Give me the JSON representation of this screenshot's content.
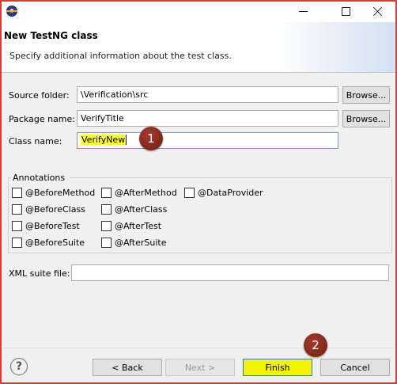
{
  "window": {
    "title": "",
    "banner_title": "New TestNG class",
    "banner_subtitle": "Specify additional information about the test class."
  },
  "form": {
    "source_folder_label": "Source folder:",
    "source_folder_value": "\\Verification\\src",
    "package_name_label": "Package name:",
    "package_name_value": "VerifyTitle",
    "class_name_label": "Class name:",
    "class_name_value": "VerifyNew",
    "browse_label": "Browse...",
    "xml_suite_label": "XML suite file:",
    "xml_suite_value": ""
  },
  "annotations": {
    "title": "Annotations",
    "items": [
      {
        "label": "@BeforeMethod",
        "checked": false
      },
      {
        "label": "@AfterMethod",
        "checked": false
      },
      {
        "label": "@DataProvider",
        "checked": false
      },
      {
        "label": "@BeforeClass",
        "checked": false
      },
      {
        "label": "@AfterClass",
        "checked": false
      },
      {
        "label": "@BeforeTest",
        "checked": false
      },
      {
        "label": "@AfterTest",
        "checked": false
      },
      {
        "label": "@BeforeSuite",
        "checked": false
      },
      {
        "label": "@AfterSuite",
        "checked": false
      }
    ]
  },
  "callouts": {
    "one": "1",
    "two": "2"
  },
  "buttons": {
    "back": "< Back",
    "next": "Next >",
    "finish": "Finish",
    "cancel": "Cancel",
    "help": "?"
  },
  "colors": {
    "highlight": "#ffff33",
    "callout": "#8b2a20",
    "frame": "#d93a3a"
  }
}
